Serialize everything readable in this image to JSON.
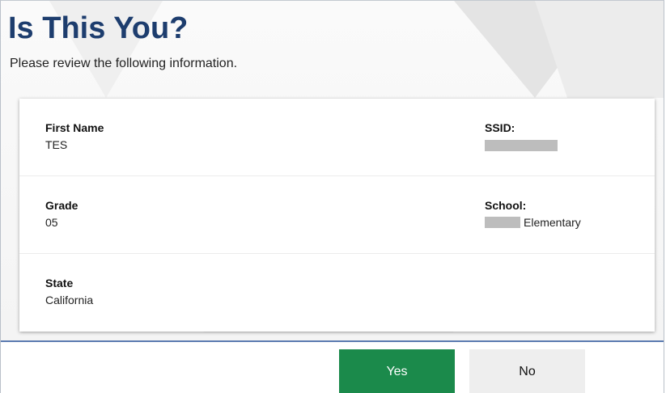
{
  "header": {
    "title": "Is This You?",
    "subtitle": "Please review the following information."
  },
  "fields": {
    "first_name": {
      "label": "First Name",
      "value": "TES"
    },
    "ssid": {
      "label": "SSID:",
      "value": ""
    },
    "grade": {
      "label": "Grade",
      "value": "05"
    },
    "school": {
      "label": "School:",
      "value": "Elementary"
    },
    "state": {
      "label": "State",
      "value": "California"
    }
  },
  "buttons": {
    "yes_label": "Yes",
    "no_label": "No"
  },
  "colors": {
    "title": "#1d3d6e",
    "yes_button": "#1b8a4b",
    "no_button": "#eeeeee",
    "divider": "#5b7bb0"
  }
}
